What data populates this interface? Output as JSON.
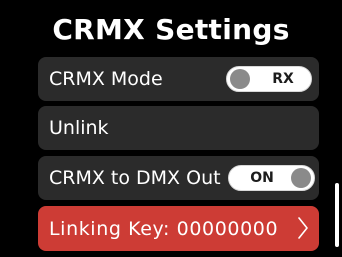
{
  "header": {
    "title": "CRMX Settings"
  },
  "rows": [
    {
      "label": "CRMX Mode",
      "toggle_label": "RX"
    },
    {
      "label": "Unlink"
    },
    {
      "label": "CRMX to DMX Out",
      "toggle_label": "ON"
    },
    {
      "label": "Linking Key: 00000000"
    }
  ],
  "colors": {
    "background": "#000000",
    "row": "#2b2b2b",
    "selected_row": "#cd3c35",
    "toggle_knob": "#8a8a8a"
  },
  "icons": {
    "row_4_trailing": "chevron-right-icon"
  }
}
